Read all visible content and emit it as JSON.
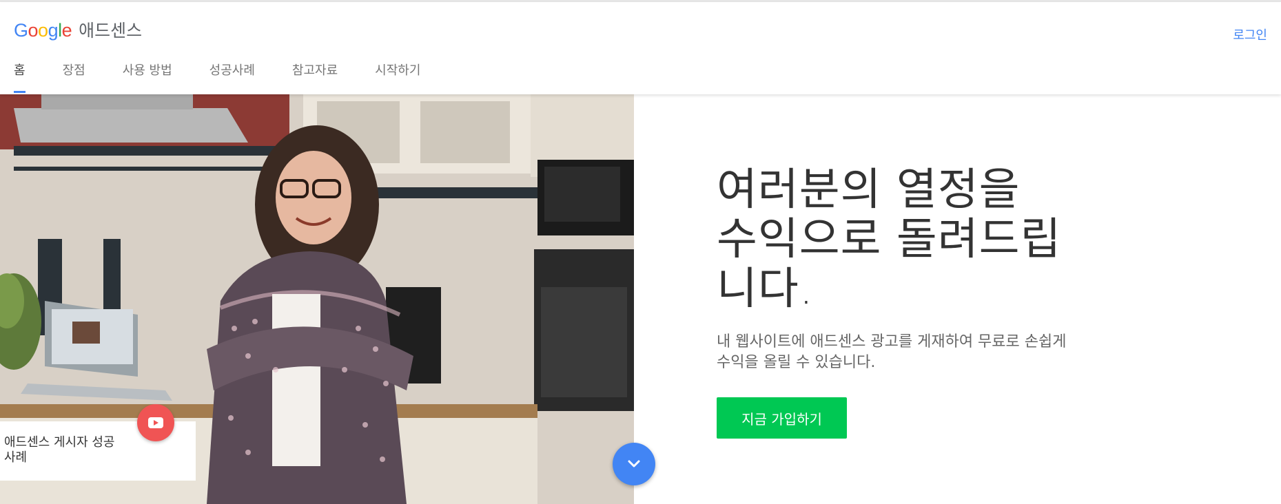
{
  "brand": {
    "letters": [
      "G",
      "o",
      "o",
      "g",
      "l",
      "e"
    ],
    "letter_colors": [
      "#4285f4",
      "#ea4335",
      "#fbbc05",
      "#4285f4",
      "#34a853",
      "#ea4335"
    ],
    "product": "애드센스"
  },
  "header": {
    "login_label": "로그인"
  },
  "nav": {
    "tabs": [
      {
        "label": "홈",
        "active": true
      },
      {
        "label": "장점",
        "active": false
      },
      {
        "label": "사용 방법",
        "active": false
      },
      {
        "label": "성공사례",
        "active": false
      },
      {
        "label": "참고자료",
        "active": false
      },
      {
        "label": "시작하기",
        "active": false
      }
    ],
    "accent_color": "#4285f4"
  },
  "hero": {
    "title_lines": [
      "여러분의 열정을",
      "수익으로 돌려드립",
      "니다."
    ],
    "subtitle": "내 웹사이트에 애드센스 광고를 게재하여 무료로 손쉽게 수익을 올릴 수 있습니다.",
    "cta_label": "지금 가입하기",
    "cta_color": "#00c853"
  },
  "video": {
    "card_label": "애드센스 게시자 성공 사례",
    "play_icon": "youtube-play-icon",
    "play_color": "#f05454"
  },
  "scroll": {
    "icon": "chevron-down-icon",
    "color": "#4285f4"
  }
}
